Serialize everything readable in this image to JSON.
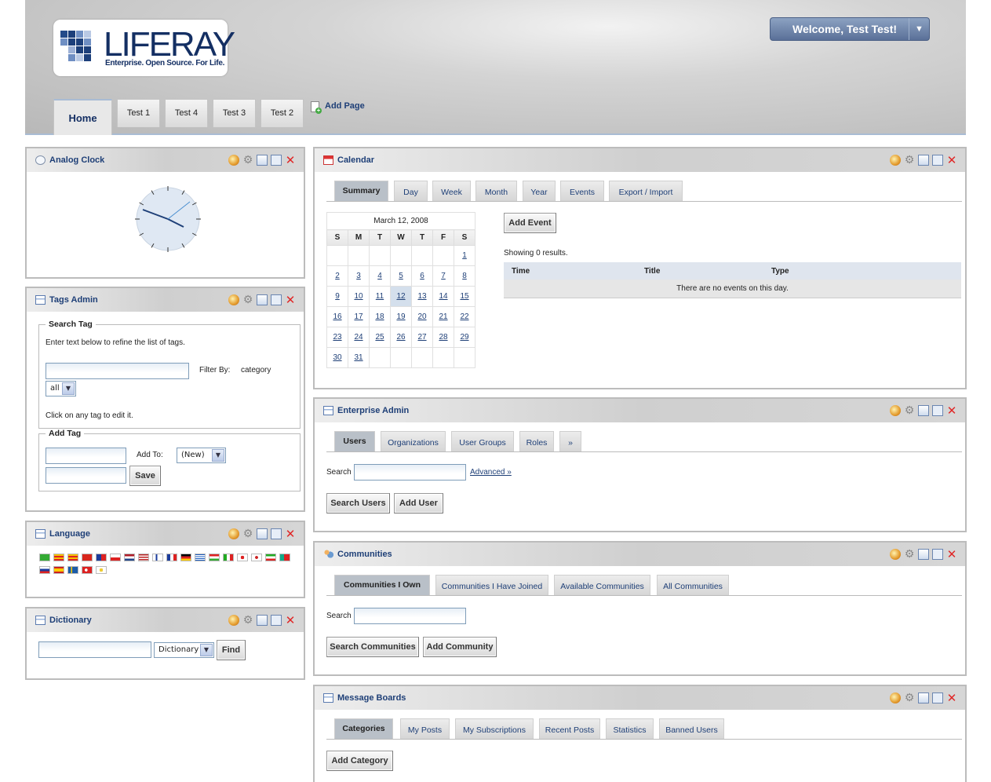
{
  "logo": {
    "brand": "LIFERAY",
    "tagline": "Enterprise. Open Source. For Life."
  },
  "user": {
    "welcome": "Welcome, Test Test!"
  },
  "nav": {
    "tabs": [
      {
        "label": "Home"
      },
      {
        "label": "Test 1"
      },
      {
        "label": "Test 4"
      },
      {
        "label": "Test 3"
      },
      {
        "label": "Test 2"
      }
    ],
    "add_page": "Add Page"
  },
  "colors": {
    "accent": "#1e3f77",
    "header_border": "#a9bcd4",
    "close": "#e02626"
  },
  "portlet_controls": [
    "look-and-feel-icon",
    "configuration-icon",
    "minimize-icon",
    "maximize-icon",
    "close-icon"
  ],
  "clock": {
    "title": "Analog Clock"
  },
  "tags": {
    "title": "Tags Admin",
    "search_legend": "Search Tag",
    "instructions": "Enter text below to refine the list of tags.",
    "filter_label": "Filter By:",
    "filter_value": "category",
    "filter_select": "all",
    "click_hint": "Click on any tag to edit it.",
    "add_legend": "Add Tag",
    "add_to_label": "Add To:",
    "add_to_value": "(New)",
    "save": "Save"
  },
  "language": {
    "title": "Language",
    "flags": [
      "arabic-flag-icon",
      "catalan-flag-icon",
      "catalan-flag-icon",
      "chinese-flag-icon",
      "taiwan-flag-icon",
      "czech-flag-icon",
      "dutch-flag-icon",
      "english-flag-icon",
      "finnish-flag-icon",
      "french-flag-icon",
      "german-flag-icon",
      "greek-flag-icon",
      "hungarian-flag-icon",
      "italian-flag-icon",
      "japanese-flag-icon",
      "korean-flag-icon",
      "persian-flag-icon",
      "portuguese-flag-icon",
      "russian-flag-icon",
      "spanish-flag-icon",
      "swedish-flag-icon",
      "turkish-flag-icon",
      "vietnamese-flag-icon"
    ]
  },
  "dictionary": {
    "title": "Dictionary",
    "select": "Dictionary",
    "find": "Find"
  },
  "calendar": {
    "title": "Calendar",
    "tabs": [
      "Summary",
      "Day",
      "Week",
      "Month",
      "Year",
      "Events",
      "Export / Import"
    ],
    "month_label": "March 12, 2008",
    "weekdays": [
      "S",
      "M",
      "T",
      "W",
      "T",
      "F",
      "S"
    ],
    "weeks": [
      [
        "",
        "",
        "",
        "",
        "",
        "",
        "1"
      ],
      [
        "2",
        "3",
        "4",
        "5",
        "6",
        "7",
        "8"
      ],
      [
        "9",
        "10",
        "11",
        "12",
        "13",
        "14",
        "15"
      ],
      [
        "16",
        "17",
        "18",
        "19",
        "20",
        "21",
        "22"
      ],
      [
        "23",
        "24",
        "25",
        "26",
        "27",
        "28",
        "29"
      ],
      [
        "30",
        "31",
        "",
        "",
        "",
        "",
        ""
      ]
    ],
    "add_event": "Add Event",
    "results": "Showing 0 results.",
    "columns": [
      "Time",
      "Title",
      "Type"
    ],
    "empty": "There are no events on this day."
  },
  "enterprise": {
    "title": "Enterprise Admin",
    "tabs": [
      "Users",
      "Organizations",
      "User Groups",
      "Roles",
      "»"
    ],
    "search_label": "Search",
    "advanced": "Advanced »",
    "search_users": "Search Users",
    "add_user": "Add User"
  },
  "communities": {
    "title": "Communities",
    "tabs": [
      "Communities I Own",
      "Communities I Have Joined",
      "Available Communities",
      "All Communities"
    ],
    "search_label": "Search",
    "search_button": "Search Communities",
    "add_button": "Add Community"
  },
  "boards": {
    "title": "Message Boards",
    "tabs": [
      "Categories",
      "My Posts",
      "My Subscriptions",
      "Recent Posts",
      "Statistics",
      "Banned Users"
    ],
    "add_category": "Add Category"
  }
}
